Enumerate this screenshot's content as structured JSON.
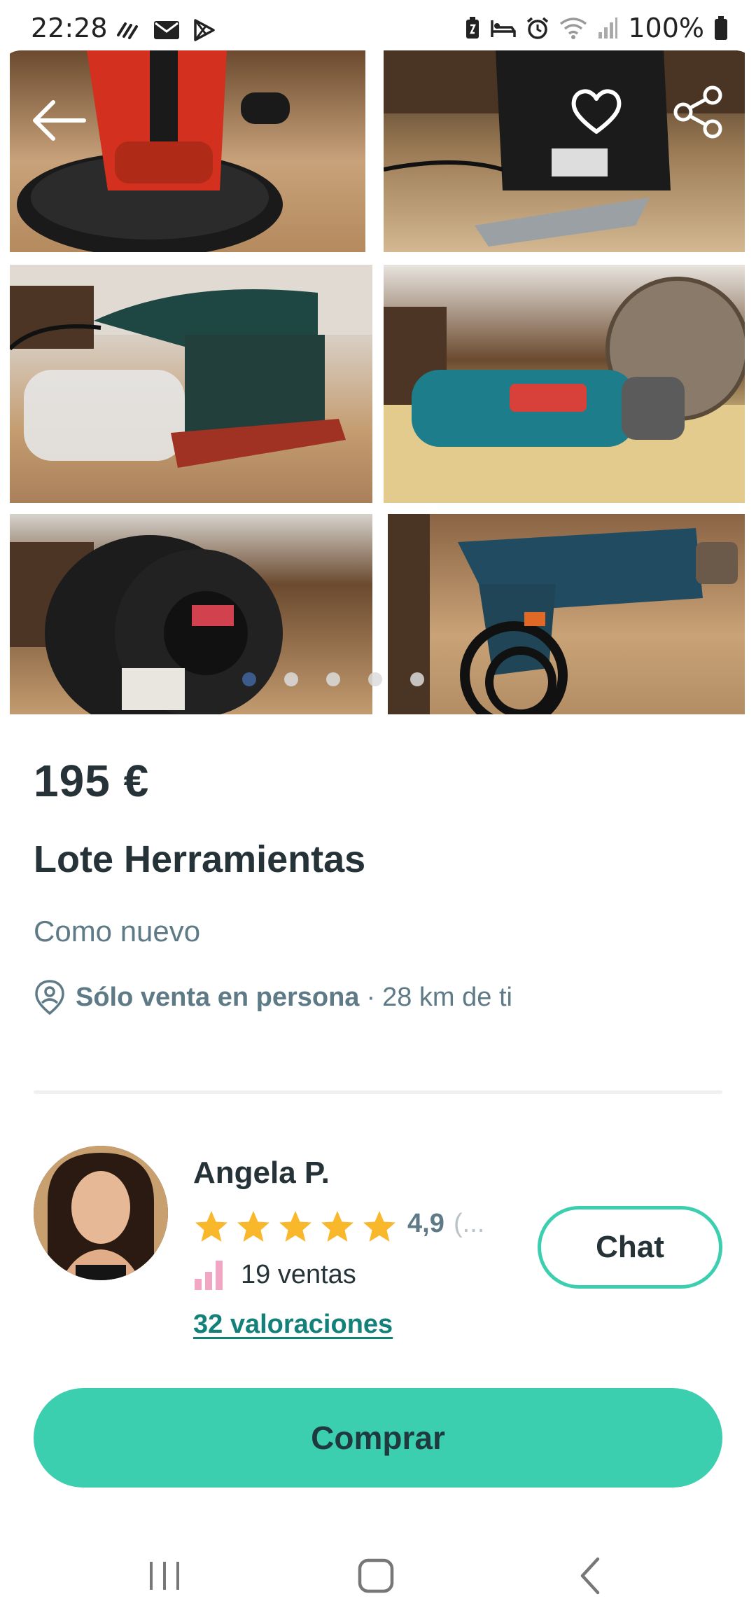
{
  "status_bar": {
    "time": "22:28",
    "battery_pct": "100%",
    "left_icons": [
      "wifi-calling-icon",
      "mail-icon",
      "play-store-icon"
    ],
    "right_icons": [
      "battery-saver-icon",
      "sleep-icon",
      "alarm-icon",
      "wifi-icon",
      "signal-icon",
      "battery-icon"
    ]
  },
  "gallery": {
    "photo_count": 6,
    "dots": 5,
    "active_dot": 0,
    "photos": [
      {
        "subject": "sander"
      },
      {
        "subject": "jigsaw"
      },
      {
        "subject": "orbital-sander"
      },
      {
        "subject": "angle-grinder"
      },
      {
        "subject": "cable-reel"
      },
      {
        "subject": "drill"
      }
    ]
  },
  "toolbar": {
    "back_icon": "arrow-left-icon",
    "favorite_icon": "heart-icon",
    "share_icon": "share-icon"
  },
  "listing": {
    "price": "195 €",
    "title": "Lote Herramientas",
    "condition": "Como nuevo",
    "shipping_label": "Sólo venta en persona",
    "separator": "·",
    "distance": "28 km de ti"
  },
  "seller": {
    "name": "Angela P.",
    "stars": 5,
    "rating": "4,9",
    "rating_more": "(...",
    "sales_label": "19 ventas",
    "reviews_label": "32 valoraciones",
    "chat_label": "Chat"
  },
  "actions": {
    "buy_label": "Comprar"
  },
  "colors": {
    "accent": "#3bcfb0",
    "text_dark": "#253238",
    "text_muted": "#5f7a87",
    "link": "#13817a",
    "star": "#f9b72c",
    "sales_icon": "#f1a7c3"
  },
  "nav_bar": {
    "items": [
      "recents-icon",
      "home-icon",
      "back-icon"
    ]
  }
}
